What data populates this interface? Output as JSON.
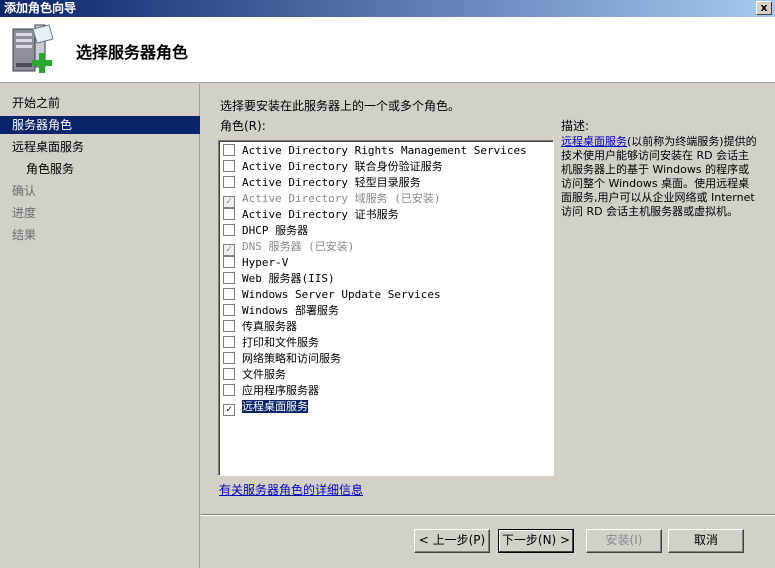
{
  "window": {
    "title": "添加角色向导",
    "close_glyph": "x"
  },
  "header": {
    "title": "选择服务器角色",
    "icon": "server-add-icon"
  },
  "sidebar": {
    "items": [
      {
        "label": "开始之前",
        "state": "normal"
      },
      {
        "label": "服务器角色",
        "state": "selected"
      },
      {
        "label": "远程桌面服务",
        "state": "normal"
      },
      {
        "label": "角色服务",
        "state": "normal"
      },
      {
        "label": "确认",
        "state": "disabled"
      },
      {
        "label": "进度",
        "state": "disabled"
      },
      {
        "label": "结果",
        "state": "disabled"
      }
    ]
  },
  "main": {
    "instruction": "选择要安装在此服务器上的一个或多个角色。",
    "roles_label": "角色(R):",
    "roles": [
      {
        "label": "Active Directory Rights Management Services",
        "checked": false,
        "installed": false
      },
      {
        "label": "Active Directory 联合身份验证服务",
        "checked": false,
        "installed": false
      },
      {
        "label": "Active Directory 轻型目录服务",
        "checked": false,
        "installed": false
      },
      {
        "label": "Active Directory 域服务  (已安装)",
        "checked": true,
        "installed": true
      },
      {
        "label": "Active Directory 证书服务",
        "checked": false,
        "installed": false
      },
      {
        "label": "DHCP 服务器",
        "checked": false,
        "installed": false
      },
      {
        "label": "DNS 服务器  (已安装)",
        "checked": true,
        "installed": true
      },
      {
        "label": "Hyper-V",
        "checked": false,
        "installed": false
      },
      {
        "label": "Web 服务器(IIS)",
        "checked": false,
        "installed": false
      },
      {
        "label": "Windows Server Update Services",
        "checked": false,
        "installed": false
      },
      {
        "label": "Windows 部署服务",
        "checked": false,
        "installed": false
      },
      {
        "label": "传真服务器",
        "checked": false,
        "installed": false
      },
      {
        "label": "打印和文件服务",
        "checked": false,
        "installed": false
      },
      {
        "label": "网络策略和访问服务",
        "checked": false,
        "installed": false
      },
      {
        "label": "文件服务",
        "checked": false,
        "installed": false
      },
      {
        "label": "应用程序服务器",
        "checked": false,
        "installed": false
      },
      {
        "label": "远程桌面服务",
        "checked": true,
        "installed": false,
        "selected": true
      }
    ],
    "more_info_link": "有关服务器角色的详细信息",
    "description_label": "描述:",
    "description_link": "远程桌面服务",
    "description_text": "(以前称为终端服务)提供的技术使用户能够访问安装在 RD 会话主机服务器上的基于 Windows 的程序或访问整个 Windows 桌面。使用远程桌面服务,用户可以从企业网络或 Internet 访问 RD 会话主机服务器或虚拟机。"
  },
  "footer": {
    "prev_label": "< 上一步(P)",
    "next_label": "下一步(N) >",
    "install_label": "安装(I)",
    "cancel_label": "取消"
  },
  "colors": {
    "selection": "#0a246a",
    "dialog_bg": "#d4d0c8",
    "link": "#0000cc"
  }
}
